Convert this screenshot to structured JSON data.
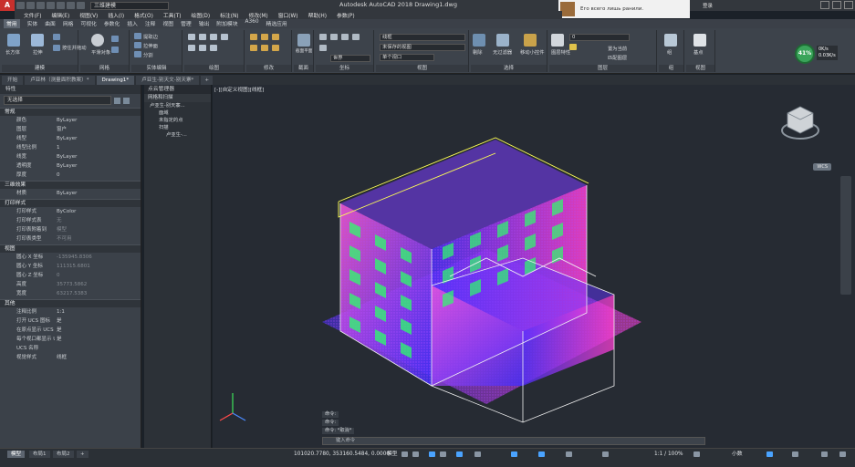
{
  "app": {
    "title": "Autodesk AutoCAD 2018   Drawing1.dwg",
    "workspace": "三维建模",
    "app_button": "A",
    "login": "登录"
  },
  "notification": {
    "text": "Его всего лишь ранили."
  },
  "network": {
    "gauge": "41%",
    "up": "0K/s",
    "down": "0.03K/s"
  },
  "menu": [
    "文件(F)",
    "编辑(E)",
    "视图(V)",
    "插入(I)",
    "格式(O)",
    "工具(T)",
    "绘图(D)",
    "标注(N)",
    "修改(M)",
    "窗口(W)",
    "帮助(H)",
    "参数(P)"
  ],
  "ribbon_tabs": [
    "常用",
    "实体",
    "曲面",
    "网格",
    "可视化",
    "参数化",
    "插入",
    "注释",
    "视图",
    "管理",
    "输出",
    "附加模块",
    "A360",
    "精选应用"
  ],
  "ribbon": {
    "panels": {
      "modeling": "建模",
      "mesh": "网格",
      "solid_edit": "实体编辑",
      "draw": "绘图",
      "modify": "修改",
      "section": "截面",
      "coordinates": "坐标",
      "view": "视图",
      "selection": "选择",
      "layers": "图层",
      "groups": "组",
      "view2": "视图"
    },
    "labels": {
      "box": "长方体",
      "extrude": "拉伸",
      "smooth": "平滑对象",
      "section_plane": "截面平面",
      "culling": "剔除",
      "no_filter": "无过滤器",
      "move_gizmo": "移动小控件",
      "layer_props": "图层特性",
      "group": "组",
      "base": "基点",
      "visual_style": "线框",
      "saved_view": "未保存的视图",
      "world": "世界",
      "single_view": "单个视口",
      "layer_select": "0",
      "extract_edges": "提取边",
      "loft": "拉伸面",
      "separate": "分割",
      "presspull": "按住并拖动",
      "union": "差集",
      "set_current": "置为当前",
      "match_layer": "匹配图层"
    }
  },
  "doc_tabs": [
    "开始",
    "卢亚林（测量面积教案）*",
    "Drawing1*",
    "卢亚生-别天文-别天寨*"
  ],
  "properties": {
    "header": "特性",
    "selection": "无选择",
    "sections": [
      {
        "name": "常规",
        "rows": [
          [
            "颜色",
            "ByLayer"
          ],
          [
            "图层",
            "窗户"
          ],
          [
            "线型",
            "ByLayer"
          ],
          [
            "线型比例",
            "1"
          ],
          [
            "线宽",
            "ByLayer"
          ],
          [
            "透明度",
            "ByLayer"
          ],
          [
            "厚度",
            "0"
          ]
        ]
      },
      {
        "name": "三维效果",
        "rows": [
          [
            "材质",
            "ByLayer"
          ]
        ]
      },
      {
        "name": "打印样式",
        "rows": [
          [
            "打印样式",
            "ByColor"
          ],
          [
            "打印样式表",
            "无"
          ],
          [
            "打印表附着到",
            "模型"
          ],
          [
            "打印表类型",
            "不可用"
          ]
        ]
      },
      {
        "name": "视图",
        "rows": [
          [
            "圆心 X 坐标",
            "-135945.8306"
          ],
          [
            "圆心 Y 坐标",
            "111315.6801"
          ],
          [
            "圆心 Z 坐标",
            "0"
          ],
          [
            "高度",
            "35773.5862"
          ],
          [
            "宽度",
            "63217.5383"
          ]
        ]
      },
      {
        "name": "其他",
        "rows": [
          [
            "注释比例",
            "1:1"
          ],
          [
            "打开 UCS 图标",
            "是"
          ],
          [
            "在原点显示 UCS 图...",
            "是"
          ],
          [
            "每个视口都显示 UCS",
            "是"
          ],
          [
            "UCS 名称",
            ""
          ],
          [
            "视觉样式",
            "线框"
          ]
        ]
      }
    ],
    "search_placeholder": "搜索"
  },
  "pointcloud_manager": {
    "header": "点云管理器",
    "subheader": "网格和扫描",
    "tree": [
      "卢亚生-别天寨...",
      "面域",
      "未指定的点",
      "扫描",
      "卢亚生-..."
    ]
  },
  "viewport": {
    "label": "[-][自定义视图][线框]",
    "viewcube_label": "WCS",
    "command_lines": [
      "命令:",
      "命令:",
      "命令:  *取消*"
    ],
    "command_prompt": "键入命令"
  },
  "status": {
    "tabs": [
      "模型",
      "布局1",
      "布局2"
    ],
    "coords": "101020.7780, 353160.5484, 0.0000",
    "model": "模型",
    "scale": "1:1 / 100%",
    "ucs": "小数"
  },
  "colors": {
    "ribbon_bg": "#3d434b",
    "viewport_bg": "#262b33",
    "cloud_main": "#6a3cff",
    "cloud_accent": "#ff4fd8",
    "window_highlight": "#2cff6a",
    "outline": "#ffff55",
    "app_red": "#c8302c"
  }
}
